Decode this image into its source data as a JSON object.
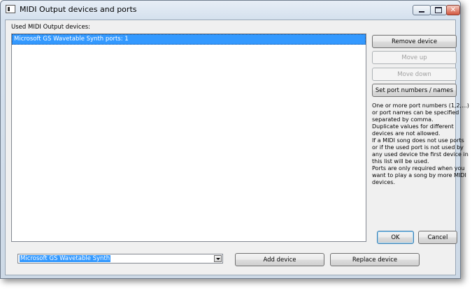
{
  "window": {
    "title": "MIDI Output devices and ports"
  },
  "main": {
    "used_label": "Used MIDI Output devices:",
    "list_items": [
      "Microsoft GS Wavetable Synth  ports: 1"
    ]
  },
  "buttons": {
    "remove": "Remove device",
    "move_up": "Move up",
    "move_down": "Move down",
    "set_ports": "Set port numbers / names",
    "ok": "OK",
    "cancel": "Cancel",
    "add": "Add device",
    "replace": "Replace device"
  },
  "info_lines": [
    "One or more port numbers (1,2,...)",
    "or port names can be specified",
    "separated by comma.",
    "Duplicate values for different",
    "devices are not allowed.",
    "If a MIDI song does not use ports",
    "or if the used port is not used by",
    "any used device the first device in",
    "this list will be used.",
    "Ports are only required when you",
    "want to play a song by more MIDI",
    "devices."
  ],
  "device_select": {
    "value": "Microsoft GS Wavetable Synth"
  },
  "colors": {
    "selection": "#3399ff",
    "close_button": "#d2573f"
  }
}
